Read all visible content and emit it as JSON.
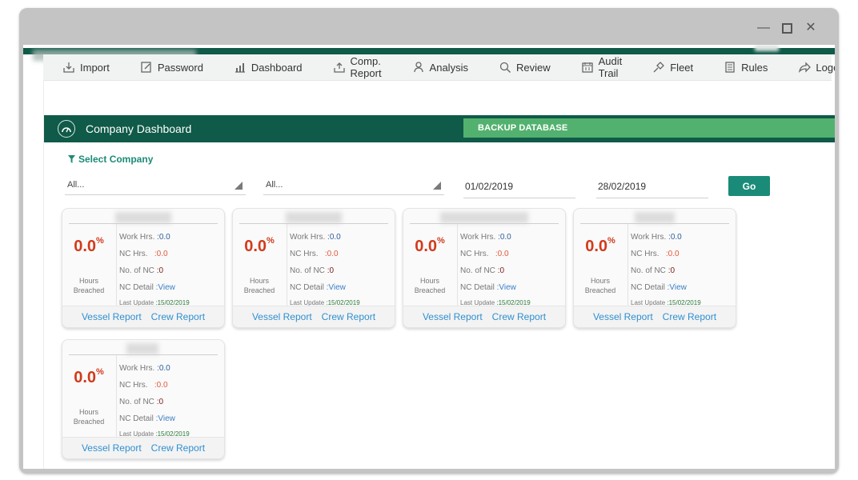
{
  "menu": [
    {
      "label": "Import",
      "icon": "import-icon"
    },
    {
      "label": "Password",
      "icon": "password-icon"
    },
    {
      "label": "Dashboard",
      "icon": "dashboard-icon"
    },
    {
      "label": "Comp. Report",
      "icon": "comp-report-icon"
    },
    {
      "label": "Analysis",
      "icon": "analysis-icon"
    },
    {
      "label": "Review",
      "icon": "search-icon"
    },
    {
      "label": "Audit Trail",
      "icon": "calendar-icon"
    },
    {
      "label": "Fleet",
      "icon": "fleet-icon"
    },
    {
      "label": "Rules",
      "icon": "rules-icon"
    },
    {
      "label": "Logout",
      "icon": "logout-icon"
    }
  ],
  "header": {
    "title": "Company Dashboard",
    "backup_label": "BACKUP DATABASE"
  },
  "filters": {
    "select_company_label": "Select Company",
    "dropdown1": "All...",
    "dropdown2": "All...",
    "date_from": "01/02/2019",
    "date_to": "28/02/2019",
    "go_label": "Go"
  },
  "cards": [
    {
      "percent": "0.0",
      "percent_sign": "%",
      "hours_line1": "Hours",
      "hours_line2": "Breached",
      "work_label": "Work Hrs.",
      "work_value": ":0.0",
      "nc_label": "NC Hrs.",
      "nc_value": ":0.0",
      "noofnc_label": "No. of NC",
      "noofnc_value": ":0",
      "detail_label": "NC Detail",
      "detail_value": ":View",
      "update_label": "Last Update",
      "update_value": ":15/02/2019",
      "vessel_report": "Vessel Report",
      "crew_report": "Crew Report"
    },
    {
      "percent": "0.0",
      "percent_sign": "%",
      "hours_line1": "Hours",
      "hours_line2": "Breached",
      "work_label": "Work Hrs.",
      "work_value": ":0.0",
      "nc_label": "NC Hrs.",
      "nc_value": ":0.0",
      "noofnc_label": "No. of NC",
      "noofnc_value": ":0",
      "detail_label": "NC Detail",
      "detail_value": ":View",
      "update_label": "Last Update",
      "update_value": ":15/02/2019",
      "vessel_report": "Vessel Report",
      "crew_report": "Crew Report"
    },
    {
      "percent": "0.0",
      "percent_sign": "%",
      "hours_line1": "Hours",
      "hours_line2": "Breached",
      "work_label": "Work Hrs.",
      "work_value": ":0.0",
      "nc_label": "NC Hrs.",
      "nc_value": ":0.0",
      "noofnc_label": "No. of NC",
      "noofnc_value": ":0",
      "detail_label": "NC Detail",
      "detail_value": ":View",
      "update_label": "Last Update",
      "update_value": ":15/02/2019",
      "vessel_report": "Vessel Report",
      "crew_report": "Crew Report"
    },
    {
      "percent": "0.0",
      "percent_sign": "%",
      "hours_line1": "Hours",
      "hours_line2": "Breached",
      "work_label": "Work Hrs.",
      "work_value": ":0.0",
      "nc_label": "NC Hrs.",
      "nc_value": ":0.0",
      "noofnc_label": "No. of NC",
      "noofnc_value": ":0",
      "detail_label": "NC Detail",
      "detail_value": ":View",
      "update_label": "Last Update",
      "update_value": ":15/02/2019",
      "vessel_report": "Vessel Report",
      "crew_report": "Crew Report"
    },
    {
      "percent": "0.0",
      "percent_sign": "%",
      "hours_line1": "Hours",
      "hours_line2": "Breached",
      "work_label": "Work Hrs.",
      "work_value": ":0.0",
      "nc_label": "NC Hrs.",
      "nc_value": ":0.0",
      "noofnc_label": "No. of NC",
      "noofnc_value": ":0",
      "detail_label": "NC Detail",
      "detail_value": ":View",
      "update_label": "Last Update",
      "update_value": ":15/02/2019",
      "vessel_report": "Vessel Report",
      "crew_report": "Crew Report"
    }
  ],
  "colors": {
    "brand_dark_green": "#0f5a48",
    "backup_green": "#53b16f",
    "go_teal": "#1a8b78",
    "percent_red": "#d23a1c",
    "link_blue": "#2f8fd0"
  }
}
